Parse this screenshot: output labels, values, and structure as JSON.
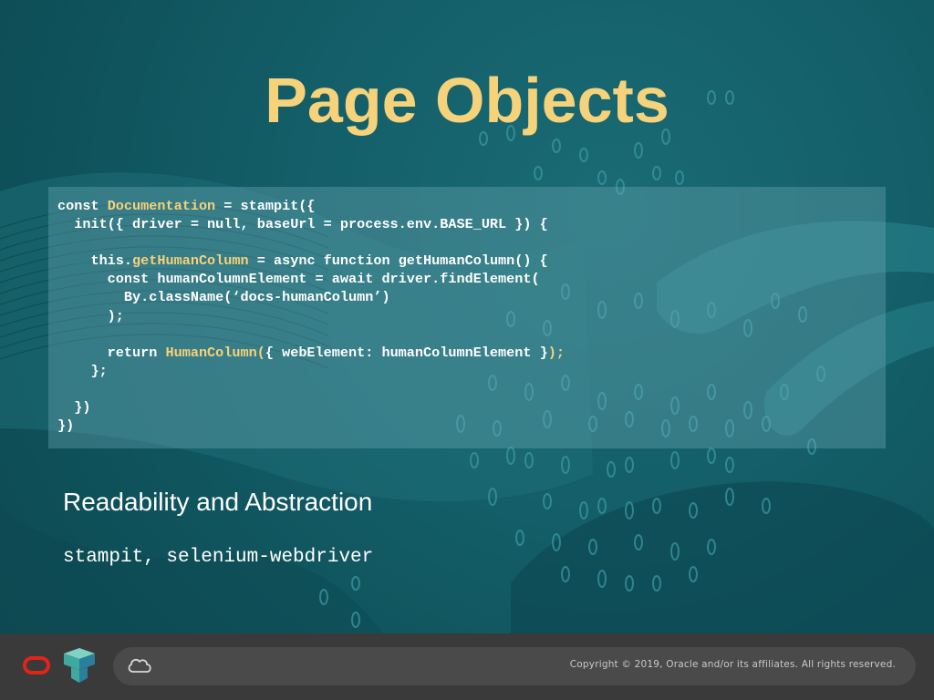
{
  "slide": {
    "title": "Page Objects",
    "subtitle": "Readability and Abstraction",
    "libraries": "stampit, selenium-webdriver",
    "accent_color": "#f6d27a",
    "background_color": "#0f4f58"
  },
  "code": {
    "lines": [
      [
        {
          "t": "const "
        },
        {
          "t": "Documentation",
          "h": true
        },
        {
          "t": " = stampit({"
        }
      ],
      [
        {
          "t": "  init({ driver = null, baseUrl = process.env.BASE_URL }) {"
        }
      ],
      [
        {
          "t": ""
        }
      ],
      [
        {
          "t": "    this."
        },
        {
          "t": "getHumanColumn",
          "h": true
        },
        {
          "t": " = async function getHumanColumn() {"
        }
      ],
      [
        {
          "t": "      const humanColumnElement = await driver.findElement("
        }
      ],
      [
        {
          "t": "        By.className(‘docs-humanColumn’)"
        }
      ],
      [
        {
          "t": "      );"
        }
      ],
      [
        {
          "t": ""
        }
      ],
      [
        {
          "t": "      return "
        },
        {
          "t": "HumanColumn(",
          "h": true
        },
        {
          "t": "{ webElement: humanColumnElement }"
        },
        {
          "t": ");",
          "h": true
        }
      ],
      [
        {
          "t": "    };"
        }
      ],
      [
        {
          "t": ""
        }
      ],
      [
        {
          "t": "  })"
        }
      ],
      [
        {
          "t": "})"
        }
      ]
    ]
  },
  "footer": {
    "copyright": "Copyright © 2019, Oracle and/or its affiliates. All rights reserved.",
    "icons": [
      "oracle-logo-icon",
      "cube-logo-icon",
      "cloud-icon"
    ],
    "oracle_color": "#e2231a"
  }
}
